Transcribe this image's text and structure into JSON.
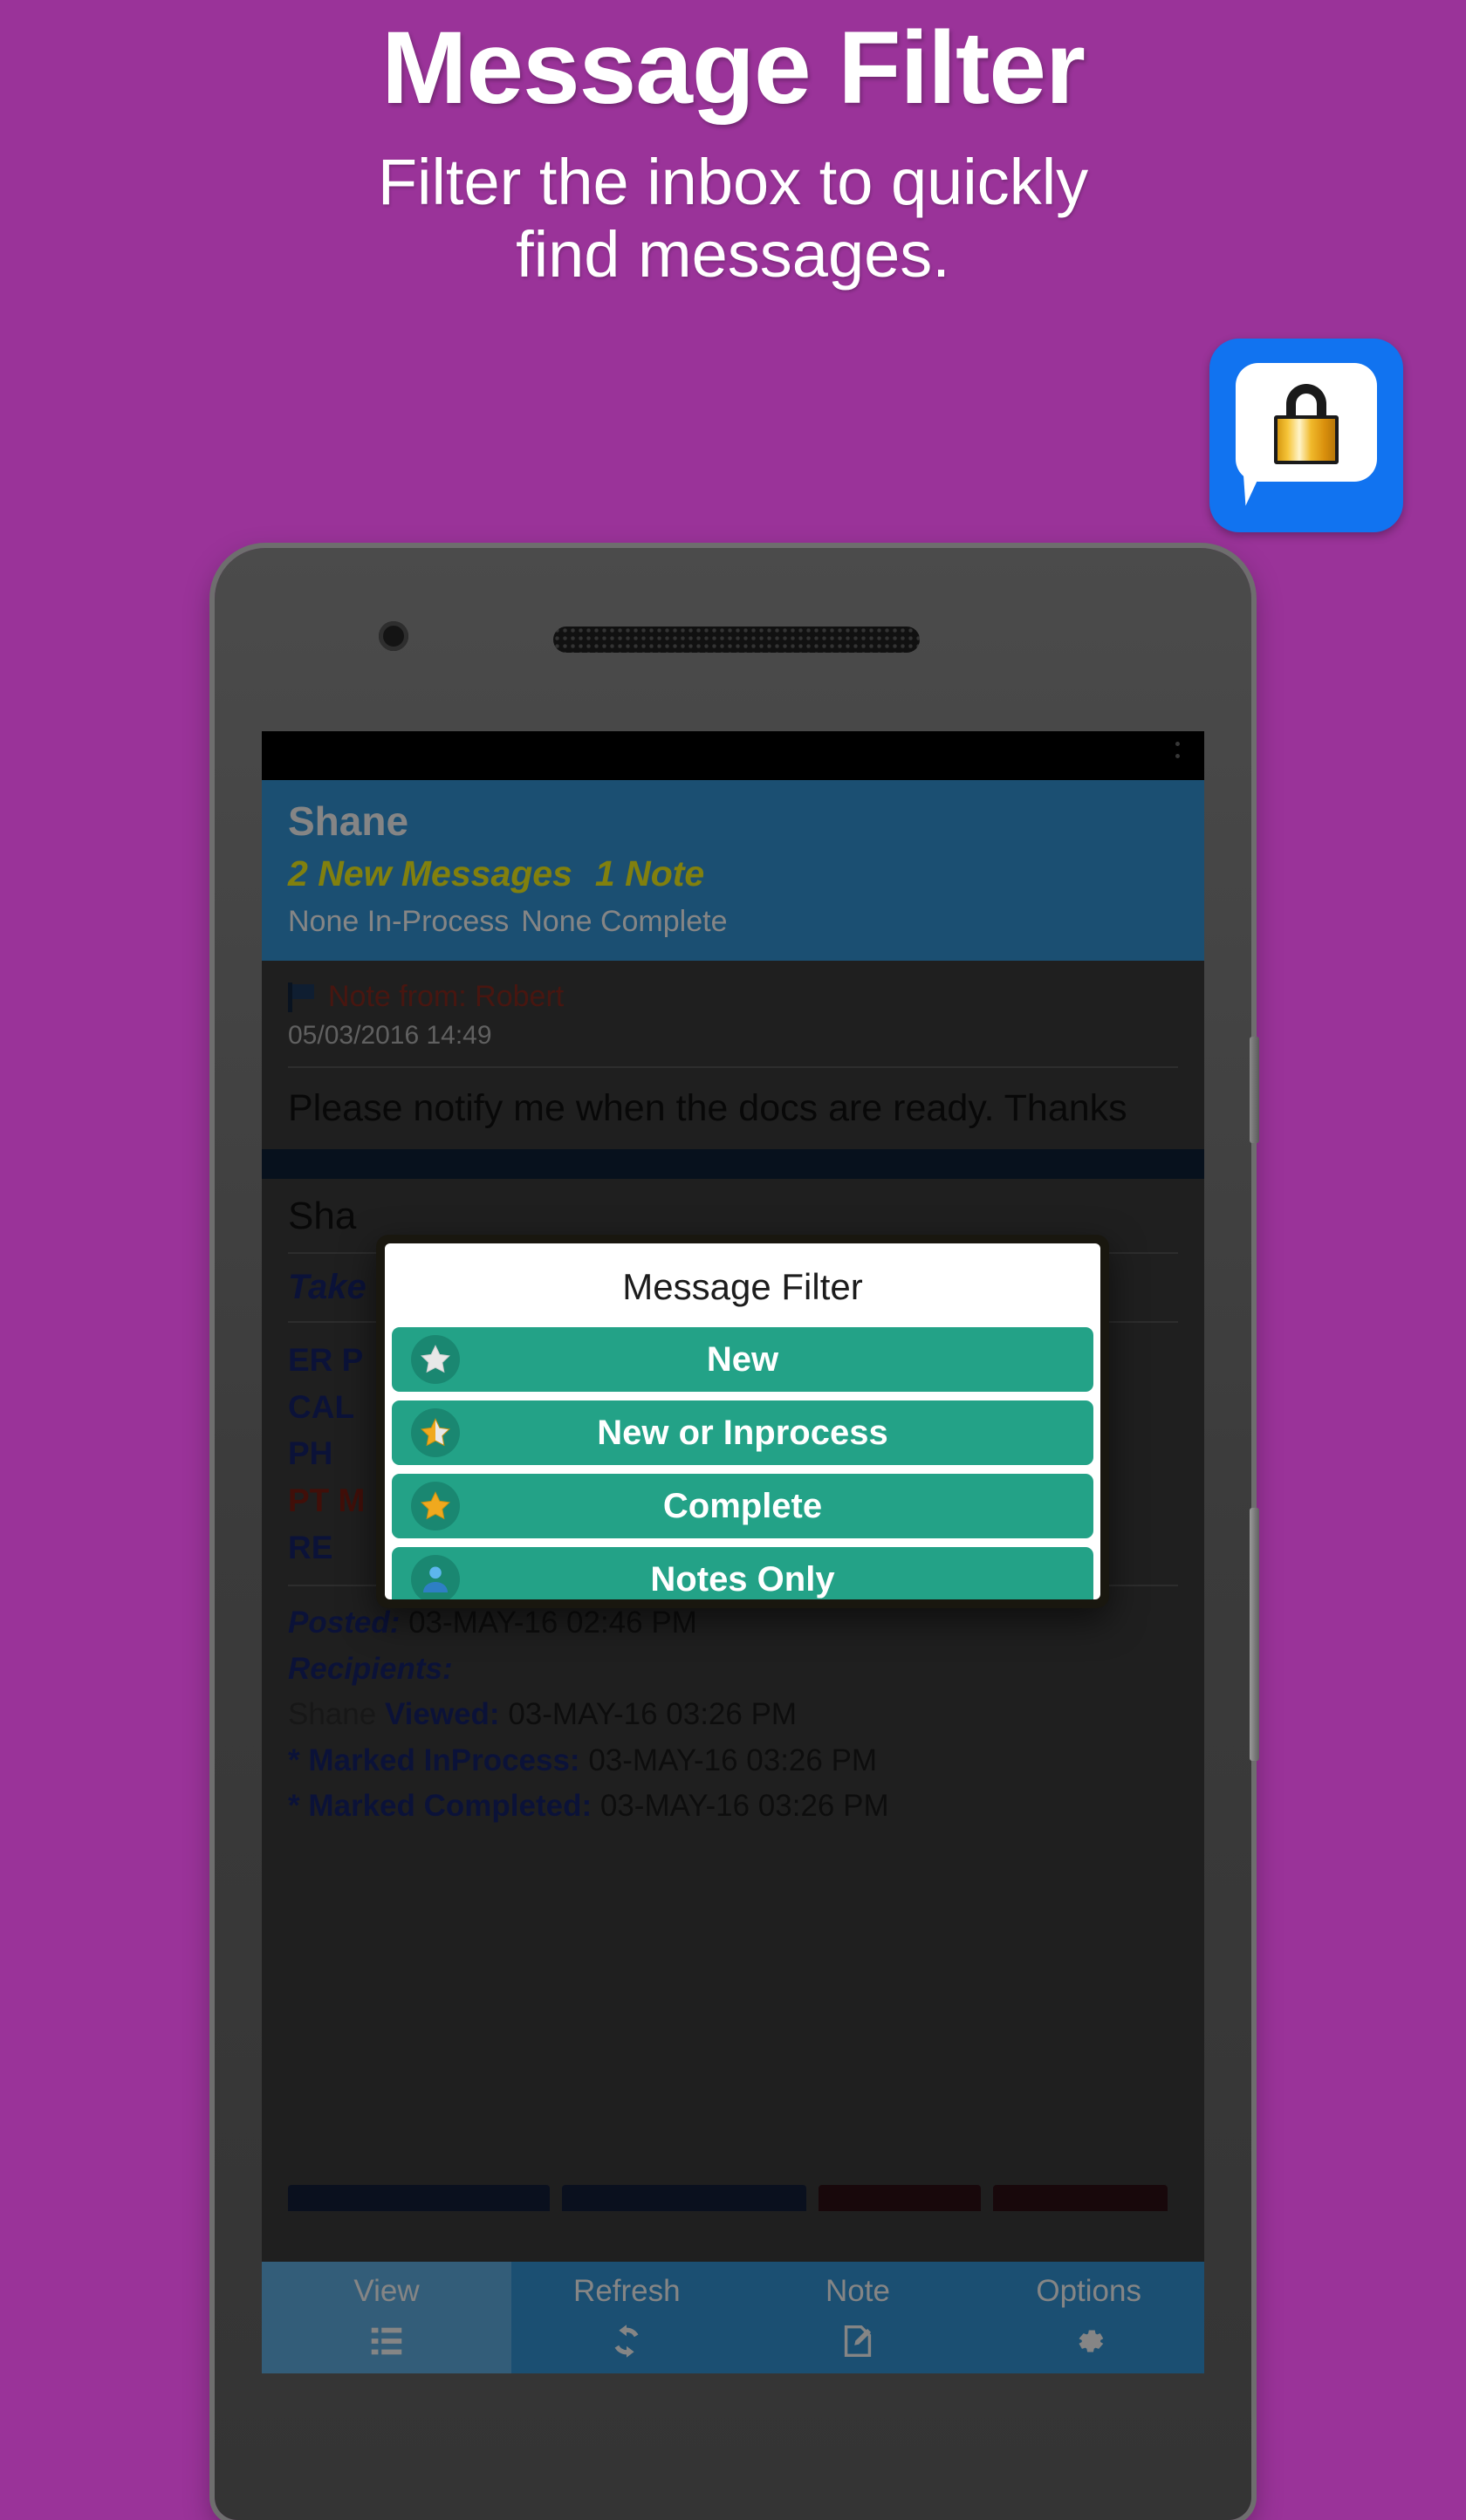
{
  "promo": {
    "title": "Message Filter",
    "subtitle_line1": "Filter the inbox to quickly",
    "subtitle_line2": "find messages."
  },
  "app_icon": {
    "name": "secure-message-lock-icon",
    "background": "#1173F0",
    "bubble": "#FFFFFF",
    "lock": "#E5A81A"
  },
  "colors": {
    "page_background": "#9A3399",
    "header_blue": "#3498DB",
    "toolbar_blue": "#3498DB",
    "toolbar_active": "#63B3E8",
    "dialog_button": "#23A287",
    "accent_yellow": "#F7F51C",
    "link_navy": "#16246B",
    "alert_red": "#7D1D12"
  },
  "statusbar": {
    "icons": "overflow-dots"
  },
  "message_header": {
    "name": "Shane",
    "new_messages": "2 New Messages",
    "notes": "1 Note",
    "in_process": "None In-Process",
    "complete": "None Complete"
  },
  "note": {
    "flag_icon": "flag-icon",
    "from": "Note from: Robert",
    "timestamp": "05/03/2016 14:49",
    "body": "Please notify me when the docs are ready. Thanks"
  },
  "message_detail": {
    "title": "Sha",
    "subject": "Take",
    "fields": [
      {
        "text": "ER P",
        "style": "navy"
      },
      {
        "text": "CAL",
        "style": "navy"
      },
      {
        "text": "PH",
        "style": "navy"
      },
      {
        "text": "PT M",
        "style": "red"
      },
      {
        "text": "RE",
        "style": "navy"
      }
    ],
    "posted_label": "Posted:",
    "posted_value": "03-MAY-16 02:46 PM",
    "recipients_label": "Recipients:",
    "recipient_name": "Shane",
    "viewed_label": "Viewed:",
    "viewed_value": "03-MAY-16 03:26 PM",
    "inprocess_label": "* Marked InProcess:",
    "inprocess_value": "03-MAY-16 03:26 PM",
    "completed_label": "* Marked Completed:",
    "completed_value": "03-MAY-16 03:26 PM"
  },
  "dialog": {
    "title": "Message Filter",
    "options": [
      {
        "label": "New",
        "icon": "star-white-icon",
        "star": "white"
      },
      {
        "label": "New or Inprocess",
        "icon": "star-half-gold-icon",
        "star": "half"
      },
      {
        "label": "Complete",
        "icon": "star-gold-icon",
        "star": "gold"
      },
      {
        "label": "Notes Only",
        "icon": "person-icon",
        "star": "person"
      }
    ]
  },
  "toolbar": {
    "items": [
      {
        "label": "View",
        "icon": "list-icon",
        "active": true
      },
      {
        "label": "Refresh",
        "icon": "refresh-icon",
        "active": false
      },
      {
        "label": "Note",
        "icon": "note-pencil-icon",
        "active": false
      },
      {
        "label": "Options",
        "icon": "gear-icon",
        "active": false
      }
    ]
  }
}
